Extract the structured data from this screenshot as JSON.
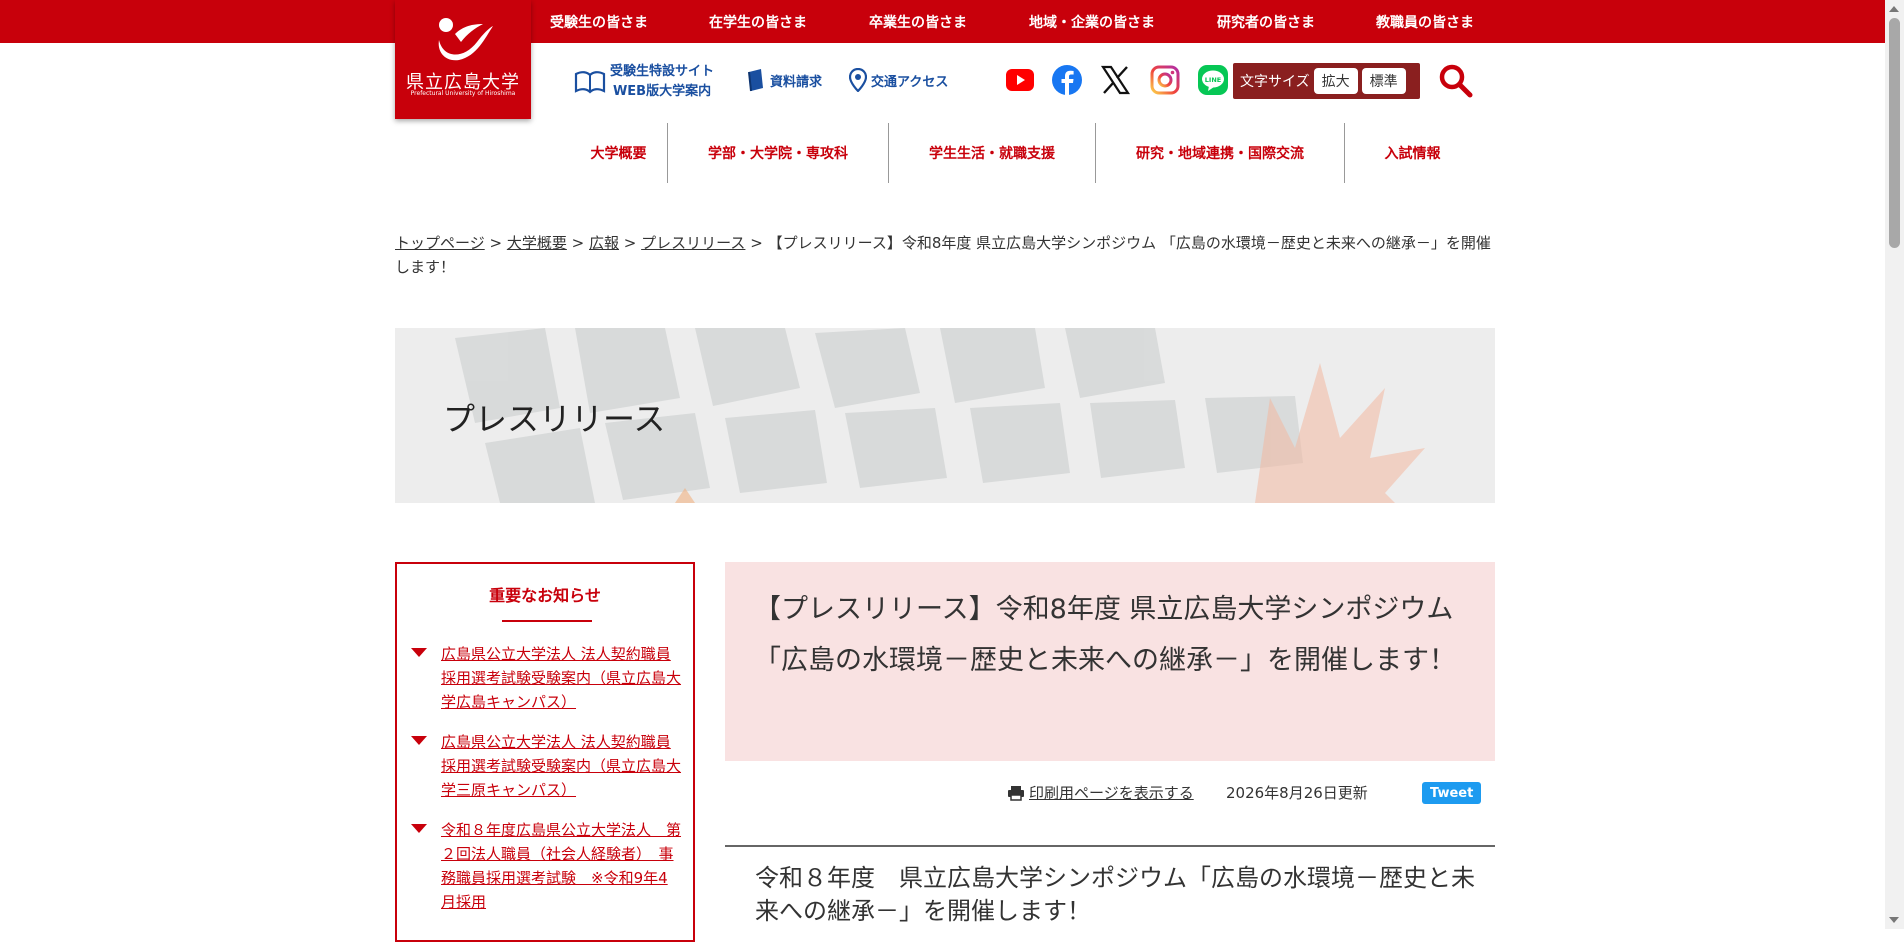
{
  "header": {
    "audience_links": [
      "受験生の皆さま",
      "在学生の皆さま",
      "卒業生の皆さま",
      "地域・企業の皆さま",
      "研究者の皆さま",
      "教職員の皆さま"
    ],
    "logo": {
      "name": "県立広島大学",
      "subtitle": "Prefectural University of Hiroshima"
    },
    "utility": {
      "exam_site_line1": "受験生特設サイト",
      "exam_site_line2": "WEB版大学案内",
      "brochure": "資料請求",
      "access": "交通アクセス"
    },
    "social_icons": [
      "youtube-icon",
      "facebook-icon",
      "x-icon",
      "instagram-icon",
      "line-icon"
    ],
    "font_size": {
      "label": "文字サイズ",
      "enlarge": "拡大",
      "standard": "標準"
    },
    "colors": {
      "brand_red": "#c8000b",
      "util_blue": "#1a4fa0",
      "headline_bg": "#f9e2e2"
    }
  },
  "global_nav": [
    "大学概要",
    "学部・大学院・専攻科",
    "学生生活・就職支援",
    "研究・地域連携・国際交流",
    "入試情報"
  ],
  "breadcrumb": {
    "items": [
      "トップページ",
      "大学概要",
      "広報",
      "プレスリリース"
    ],
    "separator": ">",
    "current": "【プレスリリース】令和8年度 県立広島大学シンポジウム 「広島の水環境－歴史と未来への継承－」を開催します！"
  },
  "banner": {
    "title": "プレスリリース"
  },
  "sidebar": {
    "title": "重要なお知らせ",
    "items": [
      "広島県公立大学法人 法人契約職員採用選考試験受験案内（県立広島大学広島キャンパス）",
      "広島県公立大学法人 法人契約職員採用選考試験受験案内（県立広島大学三原キャンパス）",
      "令和８年度広島県公立大学法人　第２回法人職員（社会人経験者）　事務職員採用選考試験　※令和9年4月採用"
    ]
  },
  "article": {
    "headline": "【プレスリリース】令和8年度 県立広島大学シンポジウム 「広島の水環境－歴史と未来への継承－」を開催します！",
    "print_link": "印刷用ページを表示する",
    "updated": "2026年8月26日更新",
    "tweet": "Tweet",
    "title": "令和８年度　県立広島大学シンポジウム「広島の水環境－歴史と未来への継承－」を開催します！"
  }
}
